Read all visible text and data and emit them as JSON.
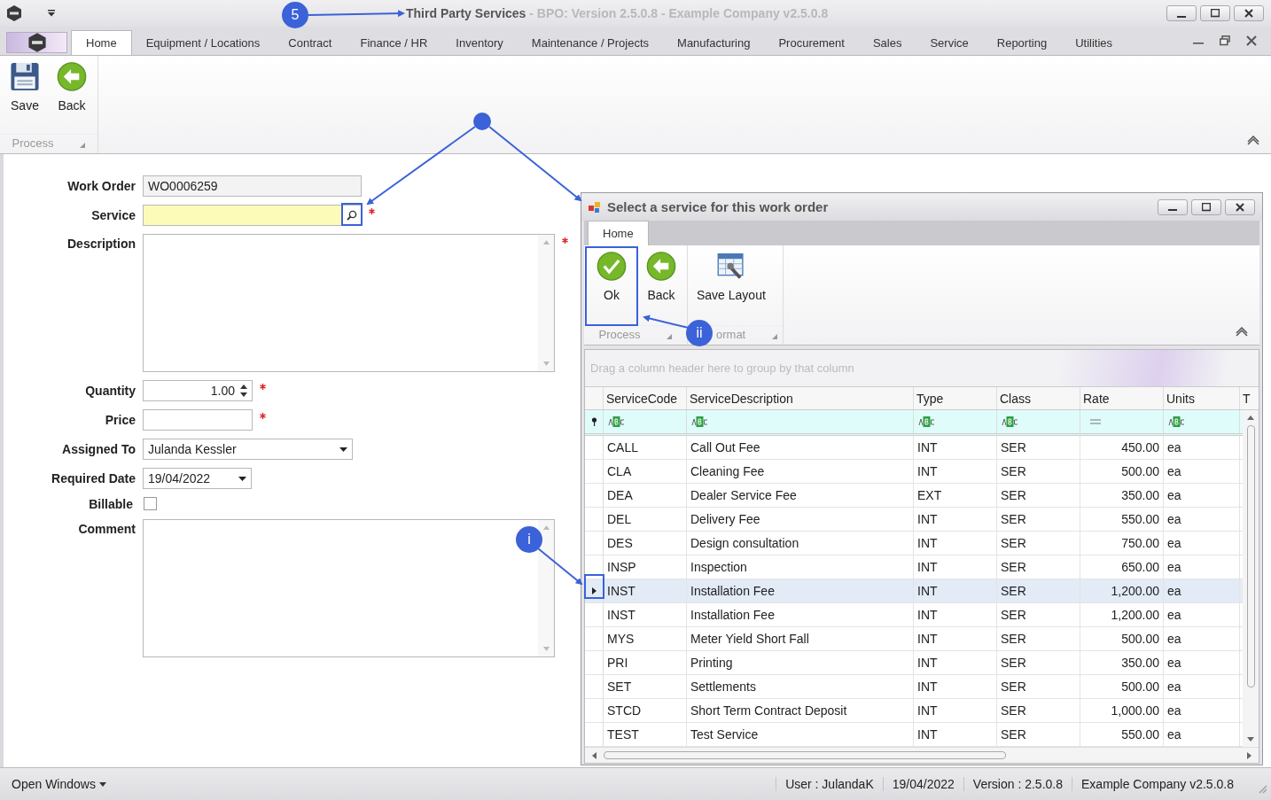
{
  "window": {
    "title": "Third Party Services",
    "subtitle": " - BPO: Version 2.5.0.8 - Example Company v2.5.0.8"
  },
  "menu_tabs": [
    {
      "label": "Home",
      "selected": true
    },
    {
      "label": "Equipment / Locations",
      "selected": false
    },
    {
      "label": "Contract",
      "selected": false
    },
    {
      "label": "Finance / HR",
      "selected": false
    },
    {
      "label": "Inventory",
      "selected": false
    },
    {
      "label": "Maintenance / Projects",
      "selected": false
    },
    {
      "label": "Manufacturing",
      "selected": false
    },
    {
      "label": "Procurement",
      "selected": false
    },
    {
      "label": "Sales",
      "selected": false
    },
    {
      "label": "Service",
      "selected": false
    },
    {
      "label": "Reporting",
      "selected": false
    },
    {
      "label": "Utilities",
      "selected": false
    }
  ],
  "ribbon": {
    "groups": [
      {
        "label": "Process",
        "buttons": [
          {
            "label": "Save",
            "kind": "save"
          },
          {
            "label": "Back",
            "kind": "back"
          }
        ]
      }
    ]
  },
  "form": {
    "fields": [
      {
        "kind": "readonly",
        "label": "Work Order",
        "value": "WO0006259",
        "required": false
      },
      {
        "kind": "lookup",
        "label": "Service",
        "required": true
      },
      {
        "kind": "memo",
        "label": "Description",
        "required": true
      },
      {
        "kind": "spin",
        "label": "Quantity",
        "value": "1.00",
        "required": true
      },
      {
        "kind": "text",
        "label": "Price",
        "required": true
      },
      {
        "kind": "dropdown",
        "label": "Assigned To",
        "value": "Julanda Kessler",
        "required": false
      },
      {
        "kind": "date",
        "label": "Required Date",
        "value": "19/04/2022",
        "required": false
      },
      {
        "kind": "checkbox",
        "label": "Billable",
        "checked": false,
        "required": false
      },
      {
        "kind": "memo",
        "label": "Comment",
        "required": false
      }
    ]
  },
  "dialog": {
    "title": "Select a service for this work order",
    "tabs": [
      {
        "label": "Home",
        "selected": true
      }
    ],
    "ribbon": {
      "groups": [
        {
          "label": "Process",
          "buttons": [
            {
              "label": "Ok",
              "kind": "ok"
            },
            {
              "label": "Back",
              "kind": "back"
            }
          ]
        },
        {
          "label": "ormat",
          "buttons": [
            {
              "label": "Save Layout",
              "kind": "layout"
            }
          ]
        }
      ]
    },
    "group_panel": "Drag a column header here to group by that column",
    "table": {
      "columns": [
        {
          "label": "ServiceCode",
          "kind": "text"
        },
        {
          "label": "ServiceDescription",
          "kind": "text"
        },
        {
          "label": "Type",
          "kind": "text"
        },
        {
          "label": "Class",
          "kind": "text"
        },
        {
          "label": "Rate",
          "kind": "number"
        },
        {
          "label": "Units",
          "kind": "text"
        },
        {
          "label": "T"
        }
      ],
      "rows": [
        {
          "cells": [
            "CALL",
            "Call Out Fee",
            "INT",
            "SER",
            "450.00",
            "ea"
          ],
          "selected": false
        },
        {
          "cells": [
            "CLA",
            "Cleaning Fee",
            "INT",
            "SER",
            "500.00",
            "ea"
          ],
          "selected": false
        },
        {
          "cells": [
            "DEA",
            "Dealer Service Fee",
            "EXT",
            "SER",
            "350.00",
            "ea"
          ],
          "selected": false
        },
        {
          "cells": [
            "DEL",
            "Delivery Fee",
            "INT",
            "SER",
            "550.00",
            "ea"
          ],
          "selected": false
        },
        {
          "cells": [
            "DES",
            "Design consultation",
            "INT",
            "SER",
            "750.00",
            "ea"
          ],
          "selected": false
        },
        {
          "cells": [
            "INSP",
            "Inspection",
            "INT",
            "SER",
            "650.00",
            "ea"
          ],
          "selected": false
        },
        {
          "cells": [
            "INST",
            "Installation Fee",
            "INT",
            "SER",
            "1,200.00",
            "ea"
          ],
          "selected": true
        },
        {
          "cells": [
            "INST",
            "Installation Fee",
            "INT",
            "SER",
            "1,200.00",
            "ea"
          ],
          "selected": false
        },
        {
          "cells": [
            "MYS",
            "Meter Yield Short Fall",
            "INT",
            "SER",
            "500.00",
            "ea"
          ],
          "selected": false
        },
        {
          "cells": [
            "PRI",
            "Printing",
            "INT",
            "SER",
            "350.00",
            "ea"
          ],
          "selected": false
        },
        {
          "cells": [
            "SET",
            "Settlements",
            "INT",
            "SER",
            "500.00",
            "ea"
          ],
          "selected": false
        },
        {
          "cells": [
            "STCD",
            "Short Term Contract Deposit",
            "INT",
            "SER",
            "1,000.00",
            "ea"
          ],
          "selected": false
        },
        {
          "cells": [
            "TEST",
            "Test Service",
            "INT",
            "SER",
            "550.00",
            "ea"
          ],
          "selected": false
        }
      ]
    }
  },
  "status_bar": {
    "menu": "Open Windows",
    "items": [
      "User : JulandaK",
      "19/04/2022",
      "Version : 2.5.0.8",
      "Example Company v2.5.0.8"
    ]
  },
  "annotations": [
    {
      "label": "5"
    },
    {
      "label": "i"
    },
    {
      "label": "ii"
    }
  ]
}
